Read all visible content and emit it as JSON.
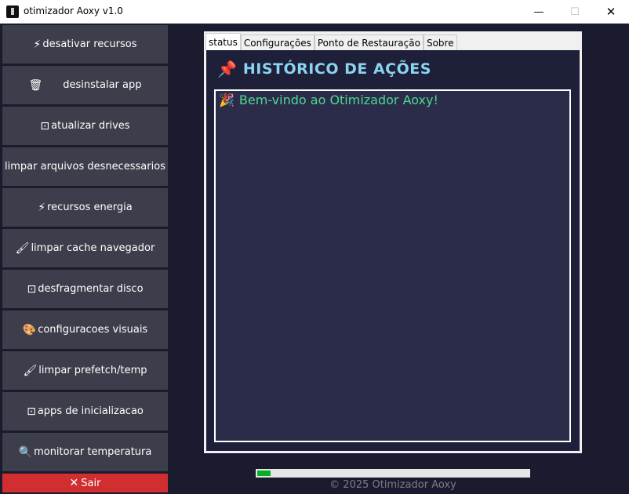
{
  "window": {
    "title": "otimizador Aoxy v1.0",
    "minimize": "—",
    "maximize": "☐",
    "close": "✕"
  },
  "sidebar": {
    "items": [
      {
        "icon": "⚡",
        "label": "desativar recursos"
      },
      {
        "icon": "🗑",
        "label": "desinstalar app"
      },
      {
        "icon": "⊡",
        "label": "atualizar drives"
      },
      {
        "icon": "",
        "label": "limpar arquivos desnecessarios"
      },
      {
        "icon": "⚡",
        "label": "recursos energia"
      },
      {
        "icon": "🖌",
        "label": "limpar cache navegador"
      },
      {
        "icon": "⊡",
        "label": "desfragmentar disco"
      },
      {
        "icon": "🎨",
        "label": "configuracoes visuais"
      },
      {
        "icon": "🖌",
        "label": "limpar prefetch/temp"
      },
      {
        "icon": "⊡",
        "label": "apps de inicializacao"
      },
      {
        "icon": "🔍",
        "label": "monitorar temperatura"
      }
    ],
    "exit": {
      "icon": "✕",
      "label": "Sair"
    }
  },
  "tabs": [
    "status",
    "Configurações",
    "Ponto de Restauração",
    "Sobre"
  ],
  "active_tab": "status",
  "status": {
    "heading_icon": "📌",
    "heading": "HISTÓRICO DE AÇÕES",
    "log": [
      {
        "icon": "🎉",
        "text": "Bem-vindo ao Otimizador Aoxy!"
      }
    ]
  },
  "progress": {
    "value_percent": 5
  },
  "footer": "© 2025 Otimizador Aoxy",
  "colors": {
    "background": "#1b1b2f",
    "button": "#3d3e4b",
    "exit": "#d12f2f",
    "heading": "#8ad4f0",
    "log_text": "#4dd990",
    "progress": "#06b025"
  }
}
